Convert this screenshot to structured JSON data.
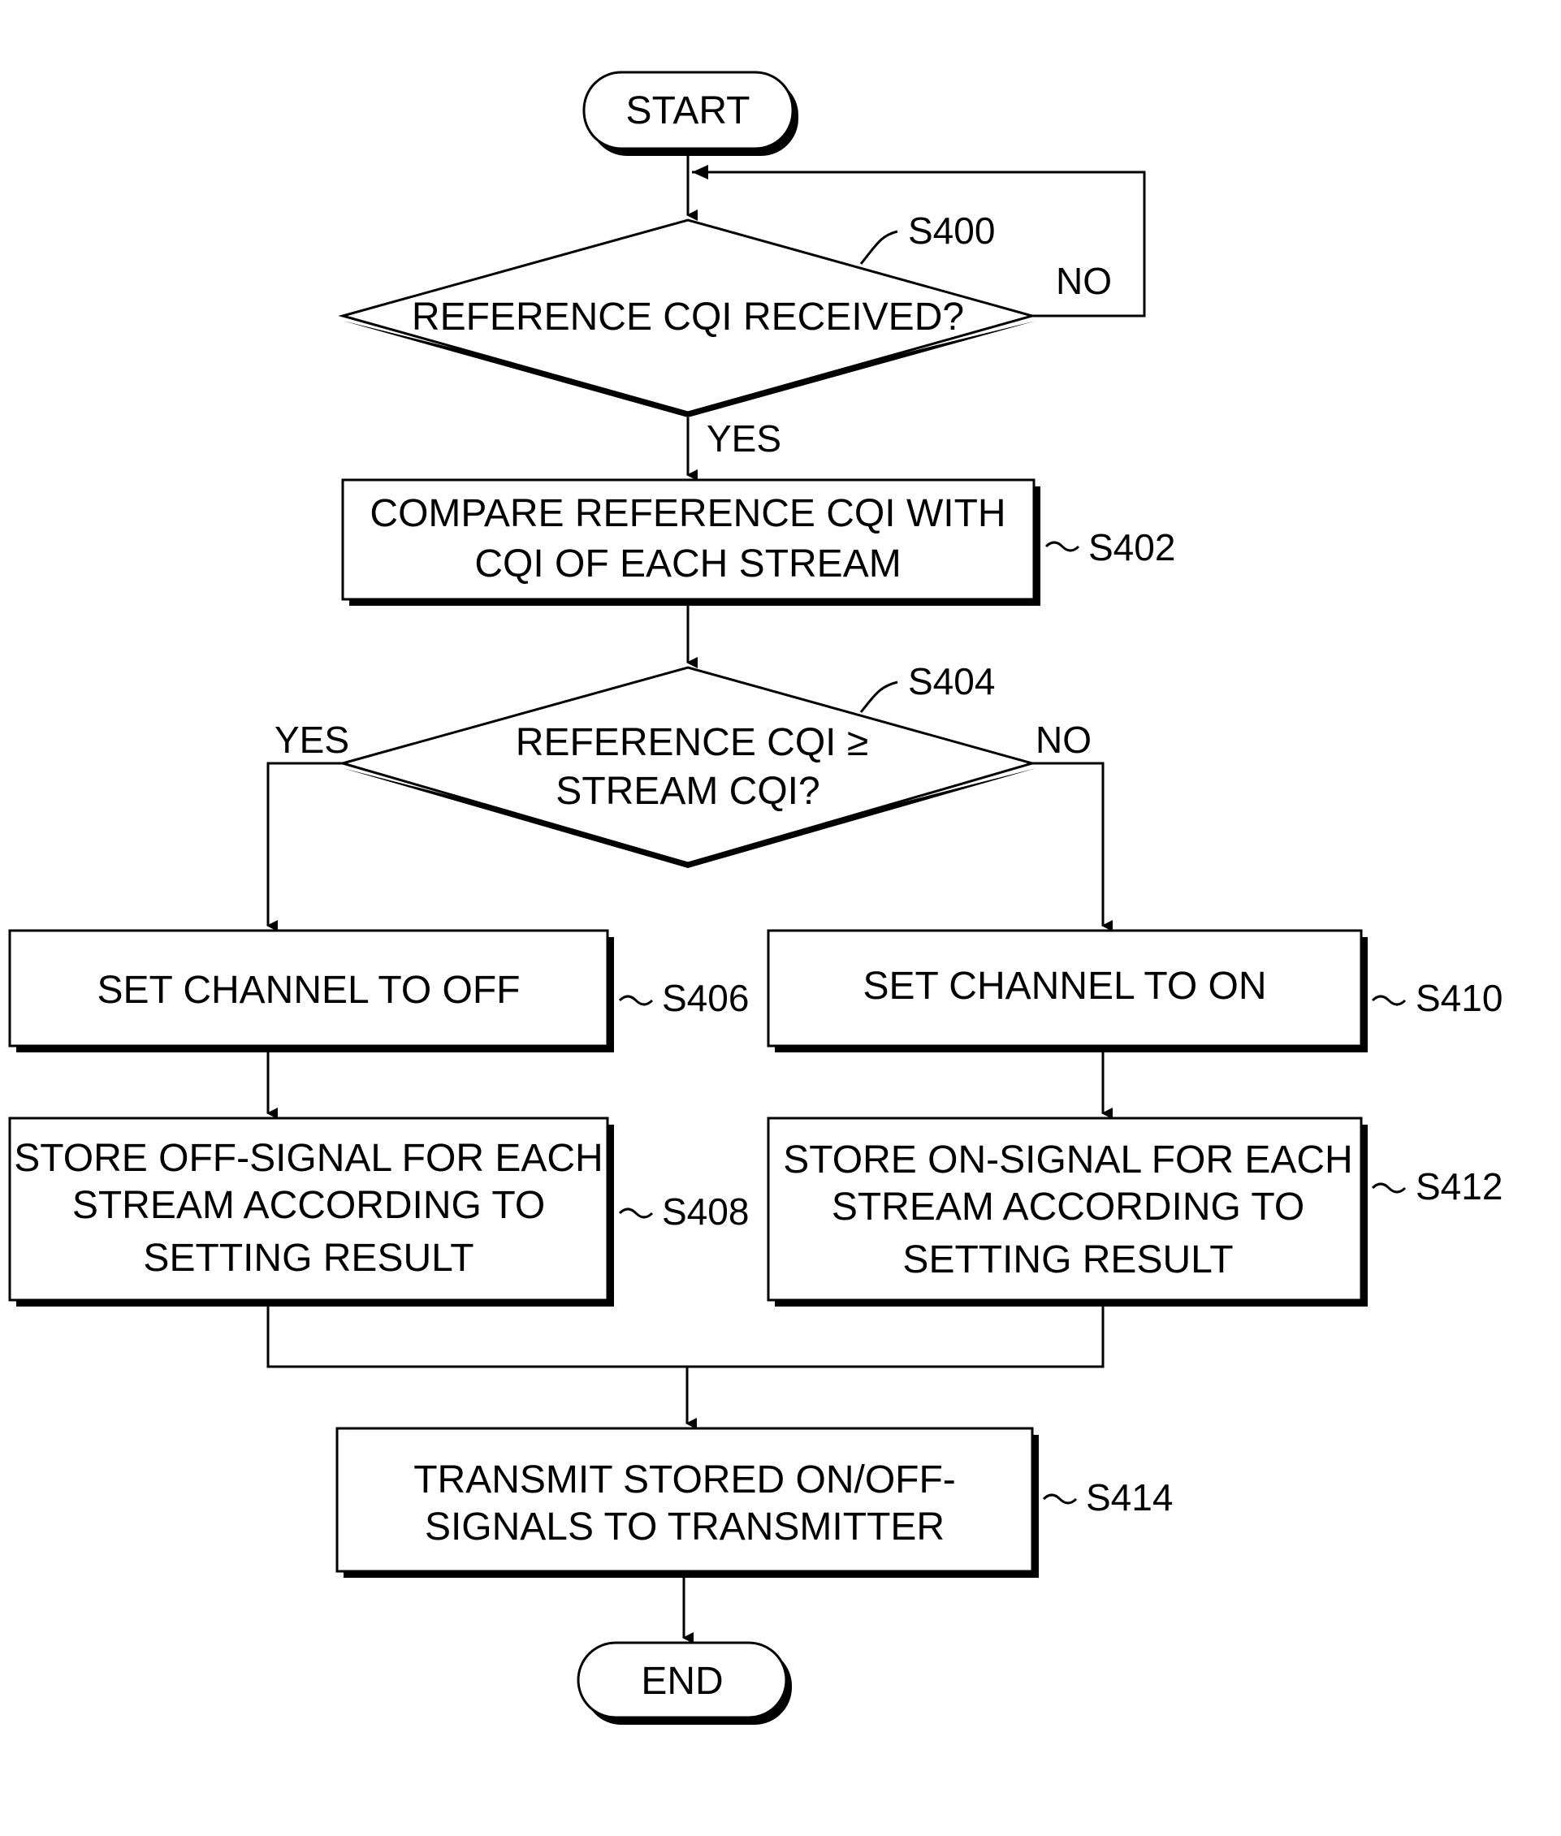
{
  "nodes": {
    "start": {
      "label": "START"
    },
    "s400": {
      "id": "S400",
      "line1": "REFERENCE CQI RECEIVED?",
      "yes": "YES",
      "no": "NO"
    },
    "s402": {
      "id": "S402",
      "line1": "COMPARE REFERENCE CQI WITH",
      "line2": "CQI OF EACH STREAM"
    },
    "s404": {
      "id": "S404",
      "line1": "REFERENCE CQI ≥",
      "line2": "STREAM CQI?",
      "yes": "YES",
      "no": "NO"
    },
    "s406": {
      "id": "S406",
      "line1": "SET CHANNEL TO OFF"
    },
    "s410": {
      "id": "S410",
      "line1": "SET CHANNEL TO ON"
    },
    "s408": {
      "id": "S408",
      "line1": "STORE OFF-SIGNAL FOR EACH",
      "line2": "STREAM ACCORDING TO",
      "line3": "SETTING RESULT"
    },
    "s412": {
      "id": "S412",
      "line1": "STORE ON-SIGNAL FOR EACH",
      "line2": "STREAM ACCORDING TO",
      "line3": "SETTING RESULT"
    },
    "s414": {
      "id": "S414",
      "line1": "TRANSMIT STORED ON/OFF-",
      "line2": "SIGNALS TO TRANSMITTER"
    },
    "end": {
      "label": "END"
    }
  }
}
